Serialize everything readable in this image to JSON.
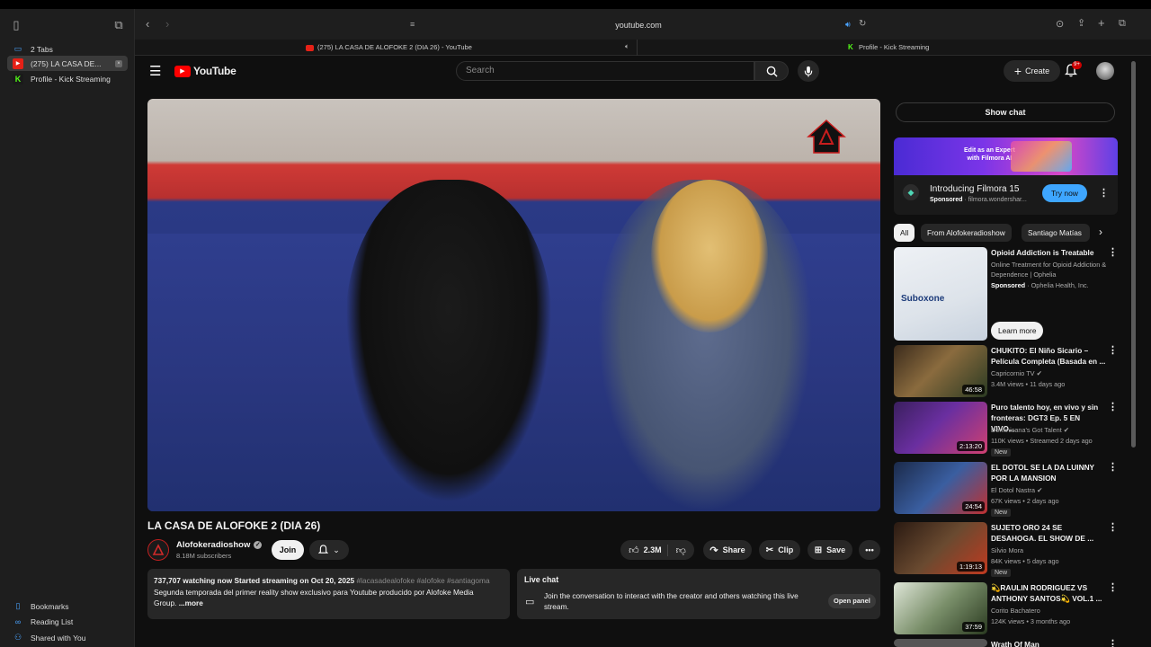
{
  "browser": {
    "address": "youtube.com",
    "tabs": [
      {
        "title": "(275) LA CASA DE ALOFOKE 2 (DIA 26) - YouTube"
      },
      {
        "title": "Profile - Kick Streaming"
      }
    ]
  },
  "sidebar": {
    "tabs_header": "2 Tabs",
    "items": [
      {
        "label": "(275) LA CASA DE..."
      },
      {
        "label": "Profile - Kick Streaming"
      }
    ],
    "bottom": [
      {
        "label": "Bookmarks"
      },
      {
        "label": "Reading List"
      },
      {
        "label": "Shared with You"
      }
    ]
  },
  "yt": {
    "logo_text": "YouTube",
    "search_placeholder": "Search",
    "create_label": "Create",
    "notif_count": "9+"
  },
  "video": {
    "title": "LA CASA DE ALOFOKE 2 (DIA 26)",
    "channel": "Alofokeradioshow",
    "subscribers": "8.18M subscribers",
    "join_label": "Join",
    "likes": "2.3M",
    "share_label": "Share",
    "clip_label": "Clip",
    "save_label": "Save",
    "desc_line1_stats": "737,707 watching now  Started streaming on Oct 20, 2025",
    "desc_line1_tags": "#lacasadealofoke #alofoke #santiagoma",
    "desc_line2": "Segunda temporada del primer reality show exclusivo para Youtube producido por Alofoke Media",
    "desc_line3": "Group.",
    "more_label": "...more"
  },
  "livechat": {
    "title": "Live chat",
    "text": "Join the conversation to interact with the creator and others watching this live stream.",
    "open_panel": "Open panel"
  },
  "right": {
    "show_chat": "Show chat",
    "ad": {
      "banner_line1": "Edit as an Expert",
      "banner_line2": "with Filmora AI",
      "title": "Introducing Filmora 15",
      "sponsored": "Sponsored",
      "source": "filmora.wondershar...",
      "cta": "Try now"
    },
    "chips": [
      "All",
      "From Alofokeradioshow",
      "Santiago Matías"
    ],
    "recs": [
      {
        "title": "Opioid Addiction is Treatable",
        "line2": "Online Treatment for Opioid Addiction & Dependence | Ophelia",
        "sponsored": "Sponsored",
        "advertiser": "Ophelia Health, Inc.",
        "cta": "Learn more",
        "thumb_text": "Suboxone"
      },
      {
        "title": "CHUKITO: El Niño Sicario – Película Completa (Basada en ...",
        "channel": "Capricornio TV",
        "meta": "3.4M views • 11 days ago",
        "duration": "46:58"
      },
      {
        "title": "Puro talento hoy, en vivo y sin fronteras: DGT3 Ep. 5 EN VIVO...",
        "channel": "Dominicana's Got Talent",
        "meta": "110K views • Streamed 2 days ago",
        "duration": "2:13:20",
        "badge": "New"
      },
      {
        "title": "EL DOTOL SE LA DA LUINNY POR LA MANSION",
        "channel": "El Dotol Nastra",
        "meta": "67K views • 2 days ago",
        "duration": "24:54",
        "badge": "New"
      },
      {
        "title": "SUJETO ORO 24 SE DESAHOGA. EL SHOW DE ...",
        "channel": "Silvio Mora",
        "meta": "84K views • 5 days ago",
        "duration": "1:19:13",
        "badge": "New"
      },
      {
        "title": "💫RAULIN RODRIGUEZ VS ANTHONY SANTOS💫 VOL.1 ...",
        "channel": "Corito Bachatero",
        "meta": "124K views • 3 months ago",
        "duration": "37:59"
      },
      {
        "title": "Wrath Of Man"
      }
    ]
  }
}
